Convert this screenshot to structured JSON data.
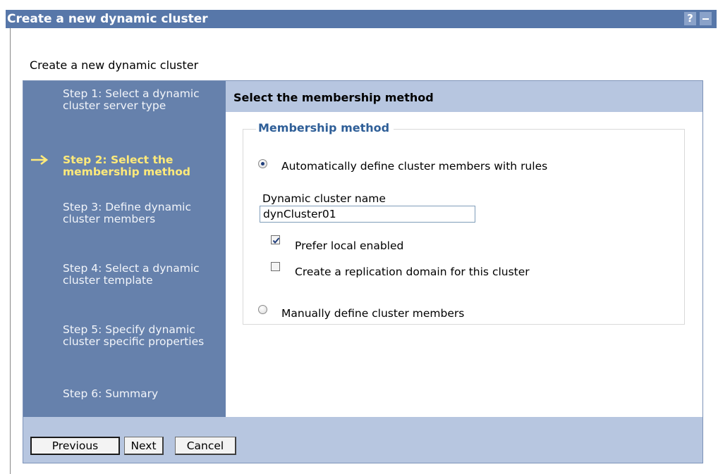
{
  "window": {
    "title": "Create a new dynamic cluster",
    "help_label": "?",
    "help_icon": "help-icon",
    "minimize_icon": "minimize-icon"
  },
  "page": {
    "heading": "Create a new dynamic cluster"
  },
  "steps": [
    {
      "label": "Step 1: Select a dynamic cluster server type",
      "current": false
    },
    {
      "label": "Step 2: Select the membership method",
      "current": true
    },
    {
      "label": "Step 3: Define dynamic cluster members",
      "current": false
    },
    {
      "label": "Step 4: Select a dynamic cluster template",
      "current": false
    },
    {
      "label": "Step 5: Specify dynamic cluster specific properties",
      "current": false
    },
    {
      "label": "Step 6: Summary",
      "current": false
    }
  ],
  "current_step_icon": "arrow-right-icon",
  "content": {
    "header": "Select the membership method",
    "fieldset_legend": "Membership method",
    "option_auto": {
      "label": "Automatically define cluster members with rules",
      "selected": true
    },
    "cluster_name_label": "Dynamic cluster name",
    "cluster_name_value": "dynCluster01",
    "prefer_local": {
      "label": "Prefer local enabled",
      "checked": true
    },
    "replication_domain": {
      "label": "Create a replication domain for this cluster",
      "checked": false
    },
    "option_manual": {
      "label": "Manually define cluster members",
      "selected": false
    }
  },
  "buttons": {
    "previous": "Previous",
    "next": "Next",
    "cancel": "Cancel"
  },
  "colors": {
    "titlebar": "#5777a9",
    "steps_panel": "#6681ac",
    "current_step": "#ffea7a",
    "header_band": "#b7c6e0",
    "legend": "#2f5f98"
  }
}
